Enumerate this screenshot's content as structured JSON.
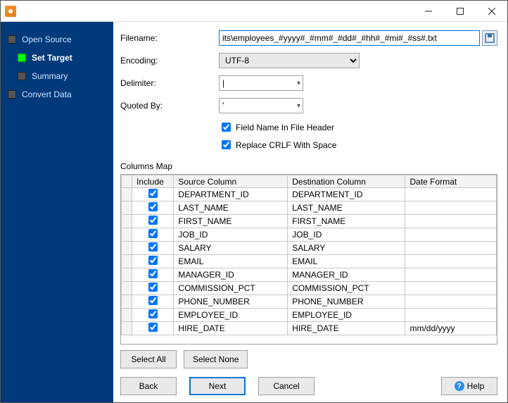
{
  "titlebar": {
    "title": ""
  },
  "sidebar": {
    "steps": [
      {
        "label": "Open Source",
        "active": false
      },
      {
        "label": "Set Target",
        "active": true
      },
      {
        "label": "Summary",
        "active": false
      },
      {
        "label": "Convert Data",
        "active": false
      }
    ]
  },
  "form": {
    "filename_label": "Filename:",
    "filename_value": "its\\employees_#yyyy#_#mm#_#dd#_#hh#_#mi#_#ss#.txt",
    "encoding_label": "Encoding:",
    "encoding_value": "UTF-8",
    "delimiter_label": "Delimiter:",
    "delimiter_value": "|",
    "quotedby_label": "Quoted By:",
    "quotedby_value": "'",
    "chk_header_label": "Field Name In File Header",
    "chk_header_checked": true,
    "chk_crlf_label": "Replace CRLF With Space",
    "chk_crlf_checked": true
  },
  "columns_map": {
    "title": "Columns Map",
    "headers": {
      "include": "Include",
      "src": "Source Column",
      "dst": "Destination Column",
      "fmt": "Date Format"
    },
    "rows": [
      {
        "include": true,
        "src": "DEPARTMENT_ID",
        "dst": "DEPARTMENT_ID",
        "fmt": ""
      },
      {
        "include": true,
        "src": "LAST_NAME",
        "dst": "LAST_NAME",
        "fmt": ""
      },
      {
        "include": true,
        "src": "FIRST_NAME",
        "dst": "FIRST_NAME",
        "fmt": ""
      },
      {
        "include": true,
        "src": "JOB_ID",
        "dst": "JOB_ID",
        "fmt": ""
      },
      {
        "include": true,
        "src": "SALARY",
        "dst": "SALARY",
        "fmt": ""
      },
      {
        "include": true,
        "src": "EMAIL",
        "dst": "EMAIL",
        "fmt": ""
      },
      {
        "include": true,
        "src": "MANAGER_ID",
        "dst": "MANAGER_ID",
        "fmt": ""
      },
      {
        "include": true,
        "src": "COMMISSION_PCT",
        "dst": "COMMISSION_PCT",
        "fmt": ""
      },
      {
        "include": true,
        "src": "PHONE_NUMBER",
        "dst": "PHONE_NUMBER",
        "fmt": ""
      },
      {
        "include": true,
        "src": "EMPLOYEE_ID",
        "dst": "EMPLOYEE_ID",
        "fmt": ""
      },
      {
        "include": true,
        "src": "HIRE_DATE",
        "dst": "HIRE_DATE",
        "fmt": "mm/dd/yyyy"
      }
    ]
  },
  "buttons": {
    "select_all": "Select All",
    "select_none": "Select None",
    "back": "Back",
    "next": "Next",
    "cancel": "Cancel",
    "help": "Help"
  }
}
